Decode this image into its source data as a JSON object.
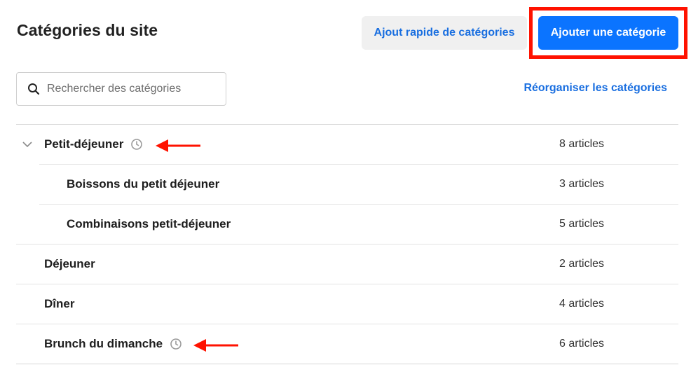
{
  "header": {
    "title": "Catégories du site",
    "quick_add_label": "Ajout rapide de catégories",
    "add_label": "Ajouter une catégorie"
  },
  "search": {
    "placeholder": "Rechercher des catégories",
    "value": ""
  },
  "reorder_label": "Réorganiser les catégories",
  "categories": [
    {
      "name": "Petit-déjeuner",
      "count": "8 articles",
      "level": 0,
      "expanded": true,
      "scheduled": true
    },
    {
      "name": "Boissons du petit déjeuner",
      "count": "3 articles",
      "level": 1,
      "scheduled": false
    },
    {
      "name": "Combinaisons petit-déjeuner",
      "count": "5 articles",
      "level": 1,
      "scheduled": false
    },
    {
      "name": "Déjeuner",
      "count": "2 articles",
      "level": 0,
      "scheduled": false
    },
    {
      "name": "Dîner",
      "count": "4 articles",
      "level": 0,
      "scheduled": false
    },
    {
      "name": "Brunch du dimanche",
      "count": "6 articles",
      "level": 0,
      "scheduled": true
    }
  ],
  "icons": {
    "search": "search-icon",
    "chevron": "chevron-down-icon",
    "clock": "clock-icon"
  },
  "colors": {
    "primary": "#0b74ff",
    "link": "#1a6fe0",
    "annotation": "#ff1200"
  }
}
